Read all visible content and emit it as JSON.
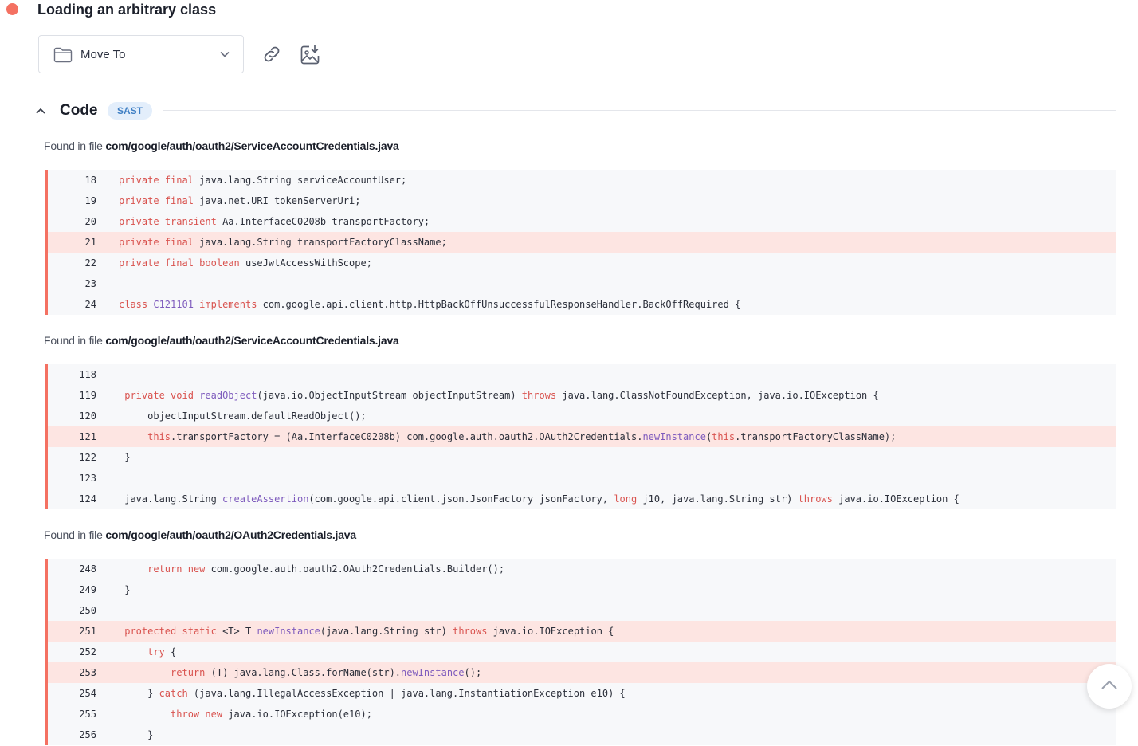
{
  "finding": {
    "title": "Loading an arbitrary class",
    "severity_color": "#f47162"
  },
  "toolbar": {
    "move_to_label": "Move To",
    "icons": [
      "folder-icon",
      "chevron-down-icon",
      "link-icon",
      "image-download-icon"
    ]
  },
  "section": {
    "label": "Code",
    "badge": "SAST"
  },
  "found_prefix": "Found in file",
  "snippets": [
    {
      "file": "com/google/auth/oauth2/ServiceAccountCredentials.java",
      "lines": [
        {
          "n": "18",
          "text": "private final java.lang.String serviceAccountUser;",
          "highlighted": false
        },
        {
          "n": "19",
          "text": "private final java.net.URI tokenServerUri;",
          "highlighted": false
        },
        {
          "n": "20",
          "text": "private transient Aa.InterfaceC0208b transportFactory;",
          "highlighted": false
        },
        {
          "n": "21",
          "text": "private final java.lang.String transportFactoryClassName;",
          "highlighted": true
        },
        {
          "n": "22",
          "text": "private final boolean useJwtAccessWithScope;",
          "highlighted": false
        },
        {
          "n": "23",
          "text": "",
          "highlighted": false
        },
        {
          "n": "24",
          "text": "class C121101 implements com.google.api.client.http.HttpBackOffUnsuccessfulResponseHandler.BackOffRequired {",
          "highlighted": false
        }
      ]
    },
    {
      "file": "com/google/auth/oauth2/ServiceAccountCredentials.java",
      "lines": [
        {
          "n": "118",
          "text": "",
          "highlighted": false
        },
        {
          "n": "119",
          "text": " private void readObject(java.io.ObjectInputStream objectInputStream) throws java.lang.ClassNotFoundException, java.io.IOException {",
          "highlighted": false
        },
        {
          "n": "120",
          "text": "     objectInputStream.defaultReadObject();",
          "highlighted": false
        },
        {
          "n": "121",
          "text": "     this.transportFactory = (Aa.InterfaceC0208b) com.google.auth.oauth2.OAuth2Credentials.newInstance(this.transportFactoryClassName);",
          "highlighted": true
        },
        {
          "n": "122",
          "text": " }",
          "highlighted": false
        },
        {
          "n": "123",
          "text": "",
          "highlighted": false
        },
        {
          "n": "124",
          "text": " java.lang.String createAssertion(com.google.api.client.json.JsonFactory jsonFactory, long j10, java.lang.String str) throws java.io.IOException {",
          "highlighted": false
        }
      ]
    },
    {
      "file": "com/google/auth/oauth2/OAuth2Credentials.java",
      "lines": [
        {
          "n": "248",
          "text": "     return new com.google.auth.oauth2.OAuth2Credentials.Builder();",
          "highlighted": false
        },
        {
          "n": "249",
          "text": " }",
          "highlighted": false
        },
        {
          "n": "250",
          "text": "",
          "highlighted": false
        },
        {
          "n": "251",
          "text": " protected static <T> T newInstance(java.lang.String str) throws java.io.IOException {",
          "highlighted": true
        },
        {
          "n": "252",
          "text": "     try {",
          "highlighted": false
        },
        {
          "n": "253",
          "text": "         return (T) java.lang.Class.forName(str).newInstance();",
          "highlighted": true
        },
        {
          "n": "254",
          "text": "     } catch (java.lang.IllegalAccessException | java.lang.InstantiationException e10) {",
          "highlighted": false
        },
        {
          "n": "255",
          "text": "         throw new java.io.IOException(e10);",
          "highlighted": false
        },
        {
          "n": "256",
          "text": "     }",
          "highlighted": false
        }
      ]
    }
  ],
  "syntax": {
    "keywords": [
      "private",
      "final",
      "transient",
      "boolean",
      "class",
      "implements",
      "void",
      "throws",
      "this",
      "long",
      "return",
      "new",
      "protected",
      "static",
      "try",
      "catch",
      "throw"
    ],
    "type_names": [
      "C121101",
      "readObject",
      "createAssertion",
      "newInstance"
    ],
    "keyword_color": "#d9534f",
    "type_color": "#7e5bbd"
  },
  "scroll_top_icon": "chevron-up-icon"
}
